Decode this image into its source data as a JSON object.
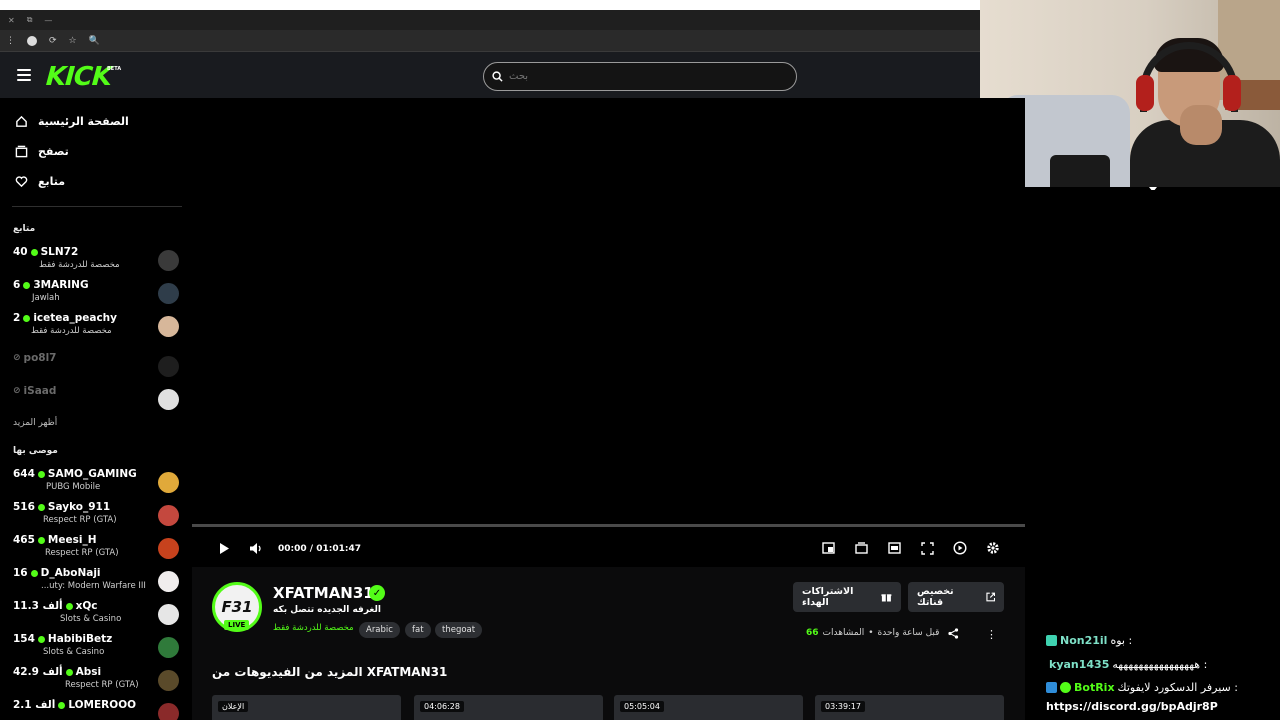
{
  "browser": {
    "tab_glyphs": [
      "✕",
      "⧉",
      "—"
    ],
    "toolbar_glyphs": [
      "⋮",
      "⚙",
      "⟳",
      "☆",
      "🔍"
    ]
  },
  "header": {
    "logo": "KICK",
    "logo_tag": "BETA",
    "search_placeholder": "بحث"
  },
  "sidebar": {
    "nav": [
      {
        "label": "الصفحة الرئيسية",
        "icon": "home-icon"
      },
      {
        "label": "تصفح",
        "icon": "browse-icon"
      },
      {
        "label": "متابع",
        "icon": "heart-icon"
      }
    ],
    "following_heading": "متابع",
    "following": [
      {
        "viewers": "40",
        "name": "SLN72",
        "category": "مخصصة للدردشة فقط",
        "avatar_color": "#3a3a3a",
        "live": true
      },
      {
        "viewers": "6",
        "name": "3MARING",
        "category": "Jawlah",
        "avatar_color": "#2f3d4a",
        "live": true
      },
      {
        "viewers": "2",
        "name": "icetea_peachy",
        "category": "مخصصة للدردشة فقط",
        "avatar_color": "#d7b79a",
        "live": true
      },
      {
        "viewers": "",
        "name": "po8l7",
        "category": "",
        "avatar_color": "#1e1e1e",
        "live": false
      },
      {
        "viewers": "",
        "name": "iSaad",
        "category": "",
        "avatar_color": "#e0e0e0",
        "live": false
      }
    ],
    "show_more": "أظهر المزيد",
    "recommended_heading": "موصى بها",
    "recommended": [
      {
        "viewers": "644",
        "name": "SAMO_GAMING",
        "category": "PUBG Mobile",
        "avatar_color": "#e0a93a"
      },
      {
        "viewers": "516",
        "name": "Sayko_911",
        "category": "Respect RP (GTA)",
        "avatar_color": "#c4483e"
      },
      {
        "viewers": "465",
        "name": "Meesi_H",
        "category": "Respect RP (GTA)",
        "avatar_color": "#c7421d"
      },
      {
        "viewers": "16",
        "name": "D_AboNaji",
        "category": "...uty: Modern Warfare III",
        "avatar_color": "#f0eded"
      },
      {
        "viewers": "11.3 ألف",
        "name": "xQc",
        "category": "Slots & Casino",
        "avatar_color": "#e6e6e6"
      },
      {
        "viewers": "154",
        "name": "HabibiBetz",
        "category": "Slots & Casino",
        "avatar_color": "#2f7a3a"
      },
      {
        "viewers": "42.9 ألف",
        "name": "Absi",
        "category": "Respect RP (GTA)",
        "avatar_color": "#5a4a2a"
      },
      {
        "viewers": "2.1 ألف",
        "name": "LOMEROOO",
        "category": "",
        "avatar_color": "#8a2a2a"
      }
    ]
  },
  "player": {
    "current_time": "00:00",
    "separator": "/",
    "duration": "01:01:47"
  },
  "stream": {
    "avatar_text": "F31",
    "live_label": "LIVE",
    "streamer": "XFATMAN31",
    "title": "الغرفه الجديده تتصل بكه",
    "category": "مخصصة للدردشة فقط",
    "tags": [
      "Arabic",
      "fat",
      "thegoat"
    ],
    "customize_button": "تخصيص قناتك",
    "gift_button": "الاشتراكات الهداء",
    "viewers_count": "66",
    "viewers_label": "المشاهدات",
    "time_ago": "قبل ساعة واحدة",
    "more_videos": "المزيد من الفيديوهات من XFATMAN31",
    "thumbnails": [
      {
        "badge": "الإعلان"
      },
      {
        "badge": "04:06:28"
      },
      {
        "badge": "05:05:04"
      },
      {
        "badge": "03:39:17"
      }
    ]
  },
  "chat": {
    "messages": [
      {
        "user": "Non21il",
        "text": "بوه :",
        "user_color": "#7ee0c7",
        "badge_color": "#3fd2b0"
      },
      {
        "user": "kyan1435",
        "text": "ههههههههههههههههه :",
        "user_color": "#7ee0c7",
        "badge_color": ""
      },
      {
        "user": "BotRix",
        "text": "سيرفر الدسكورد لايفوتك :",
        "user_color": "#53fc18",
        "badge_color": "#2f8dd9"
      },
      {
        "user": "",
        "text": "https://discord.gg/bpAdjr8P",
        "user_color": "#fff",
        "badge_color": ""
      }
    ]
  }
}
